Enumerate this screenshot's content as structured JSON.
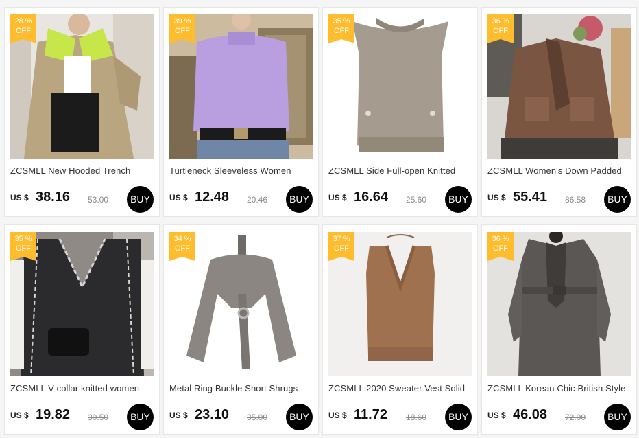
{
  "products": [
    {
      "title": "ZCSMLL New Hooded Trench",
      "discount_line1": "28 %",
      "discount_line2": "OFF",
      "currency": "US $",
      "price": "38.16",
      "original_price": "53.00",
      "buy_label": "BUY",
      "image_icon": "trench-coat-photo"
    },
    {
      "title": "Turtleneck  Sleeveless Women",
      "discount_line1": "39 %",
      "discount_line2": "OFF",
      "currency": "US $",
      "price": "12.48",
      "original_price": "20.46",
      "buy_label": "BUY",
      "image_icon": "lavender-knit-top-photo"
    },
    {
      "title": "ZCSMLL  Side Full-open Knitted",
      "discount_line1": "35 %",
      "discount_line2": "OFF",
      "currency": "US $",
      "price": "16.64",
      "original_price": "25.60",
      "buy_label": "BUY",
      "image_icon": "knitted-vest-photo"
    },
    {
      "title": "ZCSMLL Women's Down Padded",
      "discount_line1": "36 %",
      "discount_line2": "OFF",
      "currency": "US $",
      "price": "55.41",
      "original_price": "86.58",
      "buy_label": "BUY",
      "image_icon": "down-jacket-photo"
    },
    {
      "title": "ZCSMLL V collar knitted women",
      "discount_line1": "35 %",
      "discount_line2": "OFF",
      "currency": "US $",
      "price": "19.82",
      "original_price": "30.50",
      "buy_label": "BUY",
      "image_icon": "v-collar-vest-photo"
    },
    {
      "title": "Metal Ring Buckle Short Shrugs",
      "discount_line1": "34 %",
      "discount_line2": "OFF",
      "currency": "US $",
      "price": "23.10",
      "original_price": "35.00",
      "buy_label": "BUY",
      "image_icon": "shrug-cardigan-photo"
    },
    {
      "title": "ZCSMLL 2020 Sweater Vest Solid",
      "discount_line1": "37 %",
      "discount_line2": "OFF",
      "currency": "US $",
      "price": "11.72",
      "original_price": "18.60",
      "buy_label": "BUY",
      "image_icon": "sweater-vest-photo"
    },
    {
      "title": "ZCSMLL Korean Chic British Style",
      "discount_line1": "36 %",
      "discount_line2": "OFF",
      "currency": "US $",
      "price": "46.08",
      "original_price": "72.00",
      "buy_label": "BUY",
      "image_icon": "long-wool-coat-photo"
    }
  ],
  "colors": {
    "badge": "#ffbd2e",
    "buy_button": "#000000",
    "page_bg": "#f5f5f5"
  }
}
